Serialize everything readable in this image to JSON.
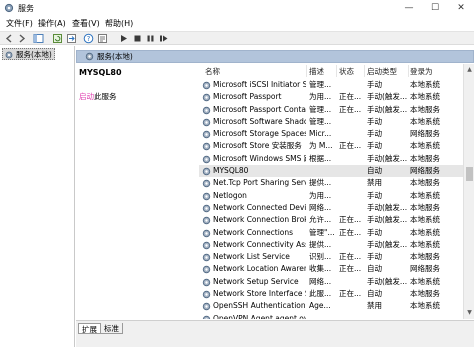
{
  "window": {
    "title": "服务",
    "controls": {
      "minimize": "—",
      "maximize": "☐",
      "close": "✕"
    }
  },
  "menu": [
    "文件(F)",
    "操作(A)",
    "查看(V)",
    "帮助(H)"
  ],
  "toolbar": {
    "icons": [
      "back-icon",
      "forward-icon",
      "show-tree-icon",
      "refresh-icon",
      "export-icon",
      "help-icon",
      "properties-icon",
      "play-icon",
      "stop-icon",
      "pause-icon",
      "restart-icon"
    ]
  },
  "tree": {
    "root_label": "服务(本地)"
  },
  "header": {
    "label": "服务(本地)"
  },
  "detail": {
    "service_name": "MYSQL80",
    "start_link": "启动",
    "start_suffix": "此服务"
  },
  "columns": [
    "名称",
    "描述",
    "状态",
    "启动类型",
    "登录为"
  ],
  "rows": [
    {
      "name": "Microsoft iSCSI Initiator Ser...",
      "desc": "管理...",
      "status": "",
      "start": "手动",
      "logon": "本地系统"
    },
    {
      "name": "Microsoft Passport",
      "desc": "为用...",
      "status": "正在...",
      "start": "手动(触发...",
      "logon": "本地系统"
    },
    {
      "name": "Microsoft Passport Container",
      "desc": "管理...",
      "status": "正在...",
      "start": "手动(触发...",
      "logon": "本地服务"
    },
    {
      "name": "Microsoft Software Shado...",
      "desc": "管理...",
      "status": "",
      "start": "手动",
      "logon": "本地系统"
    },
    {
      "name": "Microsoft Storage Spaces S...",
      "desc": "Micr...",
      "status": "",
      "start": "手动",
      "logon": "网络服务"
    },
    {
      "name": "Microsoft Store 安装服务",
      "desc": "为 M...",
      "status": "正在...",
      "start": "手动",
      "logon": "本地系统"
    },
    {
      "name": "Microsoft Windows SMS 路...",
      "desc": "根据...",
      "status": "",
      "start": "手动(触发...",
      "logon": "本地服务"
    },
    {
      "name": "MYSQL80",
      "desc": "",
      "status": "",
      "start": "自动",
      "logon": "网络服务",
      "selected": true
    },
    {
      "name": "Net.Tcp Port Sharing Service",
      "desc": "提供...",
      "status": "",
      "start": "禁用",
      "logon": "本地服务"
    },
    {
      "name": "Netlogon",
      "desc": "为用...",
      "status": "",
      "start": "手动",
      "logon": "本地系统"
    },
    {
      "name": "Network Connected Devic...",
      "desc": "网络...",
      "status": "",
      "start": "手动(触发...",
      "logon": "本地服务"
    },
    {
      "name": "Network Connection Broker",
      "desc": "允许...",
      "status": "正在...",
      "start": "手动(触发...",
      "logon": "本地系统"
    },
    {
      "name": "Network Connections",
      "desc": "管理\"...",
      "status": "正在...",
      "start": "手动",
      "logon": "本地系统"
    },
    {
      "name": "Network Connectivity Assis...",
      "desc": "提供...",
      "status": "",
      "start": "手动(触发...",
      "logon": "本地系统"
    },
    {
      "name": "Network List Service",
      "desc": "识别...",
      "status": "正在...",
      "start": "手动",
      "logon": "本地服务"
    },
    {
      "name": "Network Location Awarene...",
      "desc": "收集...",
      "status": "正在...",
      "start": "自动",
      "logon": "网络服务"
    },
    {
      "name": "Network Setup Service",
      "desc": "网络...",
      "status": "",
      "start": "手动(触发...",
      "logon": "本地系统"
    },
    {
      "name": "Network Store Interface Se...",
      "desc": "此服...",
      "status": "正在...",
      "start": "自动",
      "logon": "本地服务"
    },
    {
      "name": "OpenSSH Authentication ...",
      "desc": "Age...",
      "status": "",
      "start": "禁用",
      "logon": "本地系统"
    },
    {
      "name": "OpenVPN Agent agent.ovpnagent",
      "desc": "",
      "status": "",
      "start": "",
      "logon": ""
    }
  ],
  "tabs": [
    "扩展",
    "标准"
  ],
  "colors": {
    "header_strip": "#b2c4db",
    "start_link": "#e040b0",
    "selected_row": "#e6e6e6"
  }
}
